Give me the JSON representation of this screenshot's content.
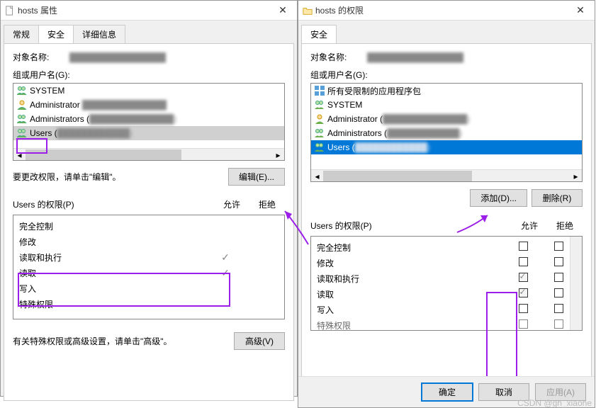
{
  "left": {
    "title": "hosts 属性",
    "tabs": {
      "general": "常规",
      "security": "安全",
      "details": "详细信息"
    },
    "objectName": {
      "label": "对象名称:"
    },
    "groupsLabel": "组或用户名(G):",
    "groups": {
      "system": "SYSTEM",
      "admin": "Administrator",
      "admins": "Administrators (",
      "users": "Users ("
    },
    "editHint": "要更改权限，请单击\"编辑\"。",
    "btn": {
      "edit": "编辑(E)...",
      "advanced": "高级(V)"
    },
    "permLabel": "Users 的权限(P)",
    "permCols": {
      "allow": "允许",
      "deny": "拒绝"
    },
    "perms": {
      "p0": "完全控制",
      "p1": "修改",
      "p2": "读取和执行",
      "p3": "读取",
      "p4": "写入",
      "p5": "特殊权限"
    },
    "advHint": "有关特殊权限或高级设置，请单击\"高级\"。"
  },
  "right": {
    "title": "hosts 的权限",
    "tab": "安全",
    "objectName": {
      "label": "对象名称:"
    },
    "groupsLabel": "组或用户名(G):",
    "groups": {
      "restricted": "所有受限制的应用程序包",
      "system": "SYSTEM",
      "admin": "Administrator (",
      "admins": "Administrators (",
      "users": "Users ("
    },
    "btn": {
      "add": "添加(D)...",
      "remove": "删除(R)",
      "ok": "确定",
      "cancel": "取消",
      "apply": "应用(A)"
    },
    "permLabel": "Users 的权限(P)",
    "permCols": {
      "allow": "允许",
      "deny": "拒绝"
    },
    "perms": {
      "p0": "完全控制",
      "p1": "修改",
      "p2": "读取和执行",
      "p3": "读取",
      "p4": "写入",
      "p5": "特殊权限"
    }
  },
  "watermark": "CSDN @gh_xiaohe"
}
